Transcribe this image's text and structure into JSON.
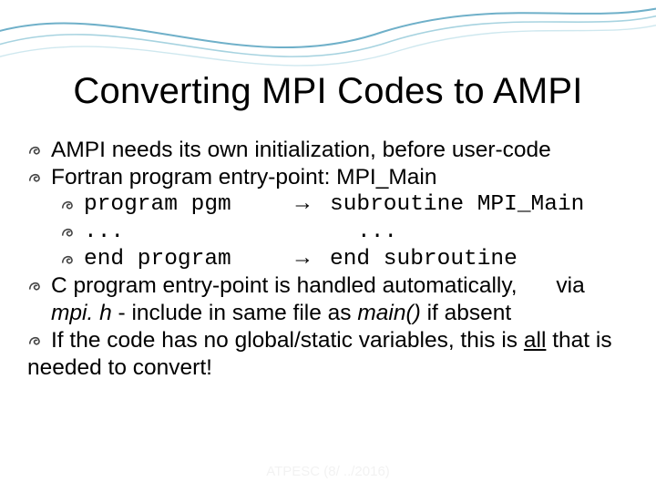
{
  "title": "Converting MPI Codes to AMPI",
  "bullets": {
    "b1": "AMPI needs its own initialization, before user-code",
    "b2": "Fortran program entry-point: MPI_Main",
    "b2a_left": "program pgm",
    "b2a_arrow": "→",
    "b2a_right": "subroutine MPI_Main",
    "b2b_left": "...",
    "b2b_right": "...",
    "b2c_left": "end program",
    "b2c_arrow": "→",
    "b2c_right": "end subroutine",
    "b3_a": "C  program entry-point is handled automatically,",
    "b3_b": "via",
    "b3_c": "mpi. h",
    "b3_d": " -  include in same file as ",
    "b3_e": "main()",
    "b3_f": "  if absent",
    "b4_a": "If  the code has no global/static variables, this is ",
    "b4_b": "all",
    "b4_c": " that is needed to convert!"
  },
  "footer": "ATPESC (8/ ../2016)"
}
